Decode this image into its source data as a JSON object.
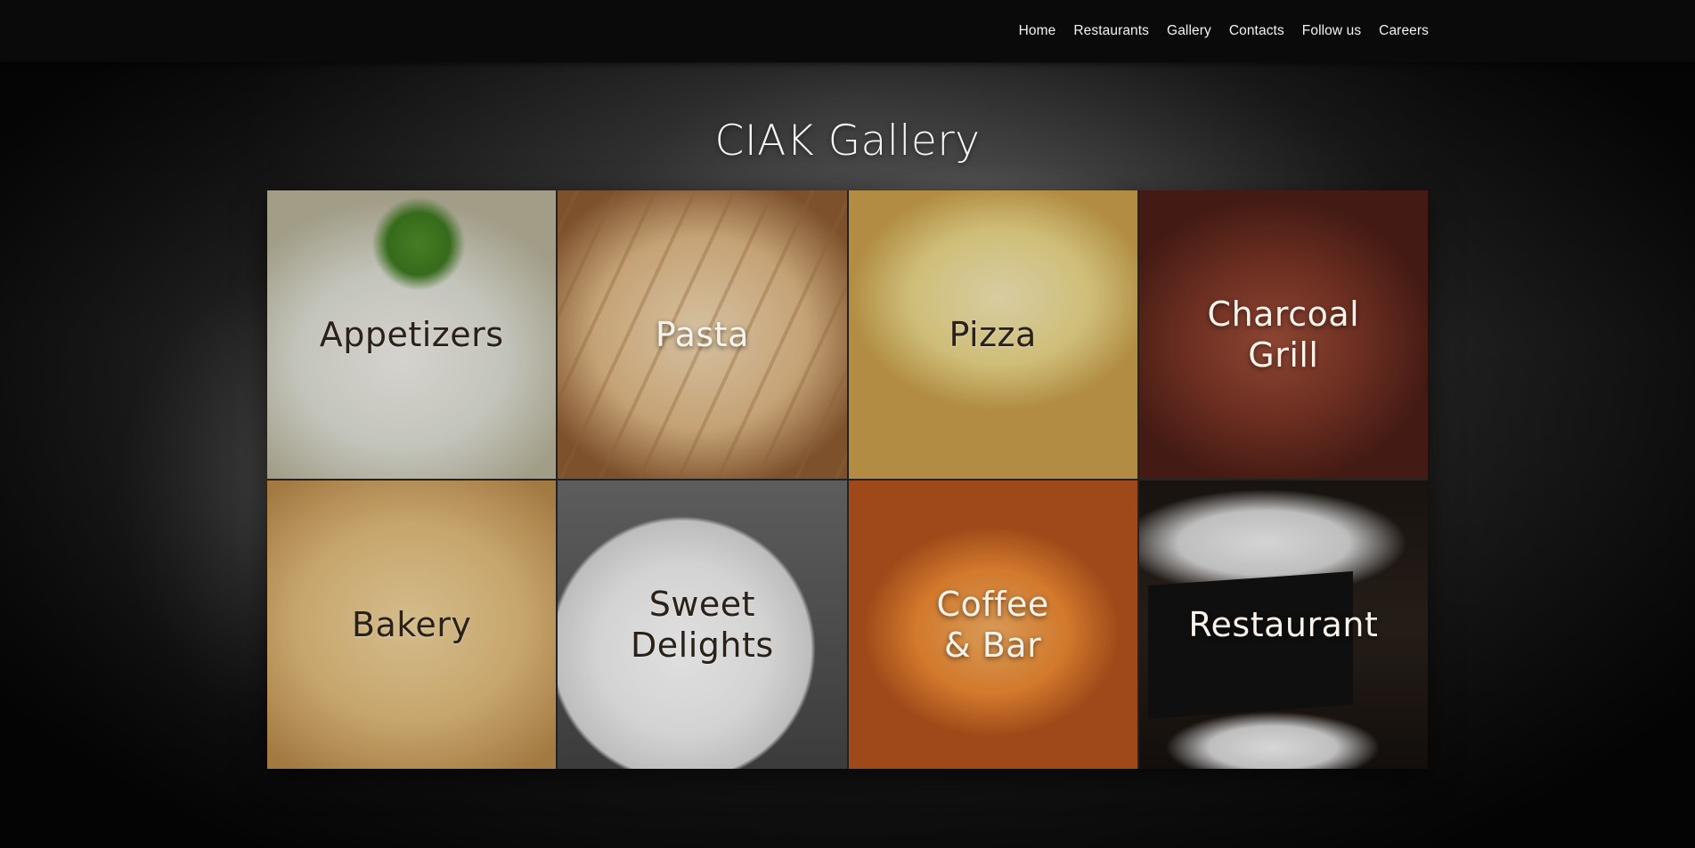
{
  "nav": {
    "items": [
      {
        "label": "Home"
      },
      {
        "label": "Restaurants"
      },
      {
        "label": "Gallery"
      },
      {
        "label": "Contacts"
      },
      {
        "label": "Follow us"
      },
      {
        "label": "Careers"
      }
    ]
  },
  "main": {
    "title": "CIAK Gallery"
  },
  "gallery": {
    "tiles": [
      {
        "label": "Appetizers"
      },
      {
        "label": "Pasta"
      },
      {
        "label": "Pizza"
      },
      {
        "label": "Charcoal\nGrill"
      },
      {
        "label": "Bakery"
      },
      {
        "label": "Sweet\nDelights"
      },
      {
        "label": "Coffee\n& Bar"
      },
      {
        "label": "Restaurant"
      }
    ]
  }
}
